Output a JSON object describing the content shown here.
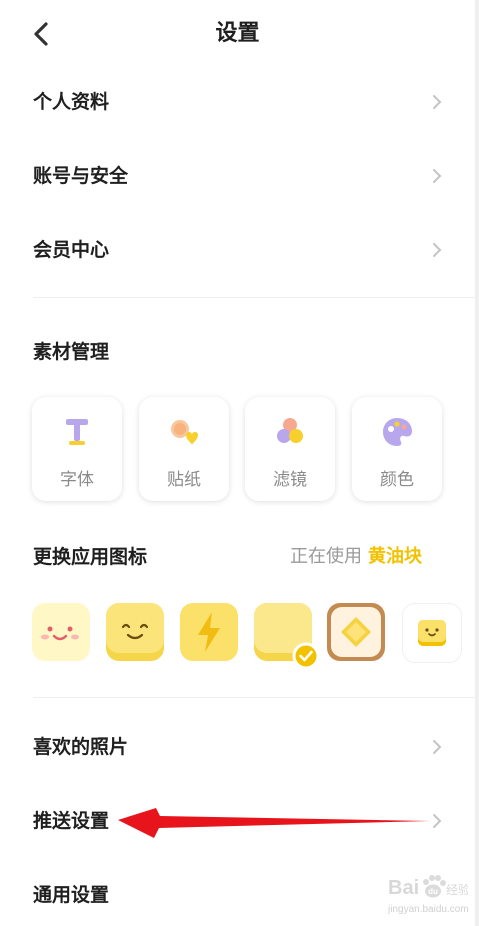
{
  "header": {
    "title": "设置",
    "back_icon": "chevron-left-icon"
  },
  "rows_top": [
    {
      "label": "个人资料"
    },
    {
      "label": "账号与安全"
    },
    {
      "label": "会员中心"
    }
  ],
  "materials": {
    "title": "素材管理",
    "items": [
      {
        "label": "字体",
        "icon": "font-icon"
      },
      {
        "label": "贴纸",
        "icon": "sticker-icon"
      },
      {
        "label": "滤镜",
        "icon": "filter-icon"
      },
      {
        "label": "颜色",
        "icon": "palette-icon"
      }
    ]
  },
  "app_icon": {
    "title": "更换应用图标",
    "status_prefix": "正在使用",
    "current": "黄油块",
    "options": [
      {
        "icon": "smile-face-pink-icon"
      },
      {
        "icon": "smile-face-yellow-icon"
      },
      {
        "icon": "lightning-icon"
      },
      {
        "icon": "butter-block-icon",
        "selected": true
      },
      {
        "icon": "toast-icon"
      },
      {
        "icon": "small-butter-icon"
      }
    ]
  },
  "rows_bottom": [
    {
      "label": "喜欢的照片"
    },
    {
      "label": "推送设置"
    },
    {
      "label": "通用设置"
    }
  ],
  "colors": {
    "accent": "#f2c200",
    "arrow": "#e8141c"
  },
  "watermark": {
    "brand": "Bai",
    "paw": "du",
    "suffix": "经验",
    "url": "jingyan.baidu.com"
  }
}
